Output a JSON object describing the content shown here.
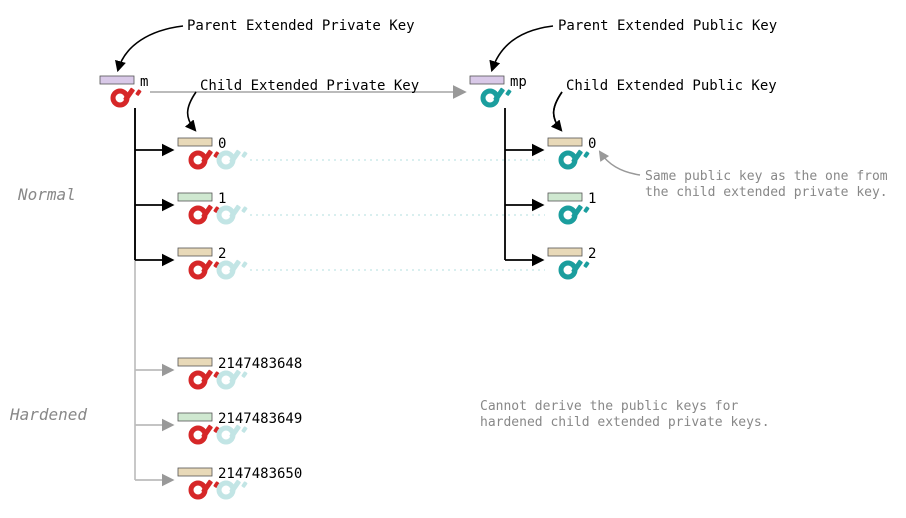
{
  "title": {
    "parent_priv": "Parent Extended Private Key",
    "parent_pub": "Parent Extended Public Key",
    "child_priv": "Child Extended Private Key",
    "child_pub": "Child Extended Public Key"
  },
  "sections": {
    "normal": "Normal",
    "hardened": "Hardened"
  },
  "master": {
    "priv_label": "m",
    "pub_label": "mp"
  },
  "normal_children": {
    "idx": [
      "0",
      "1",
      "2"
    ]
  },
  "hardened_children": {
    "idx": [
      "2147483648",
      "2147483649",
      "2147483650"
    ]
  },
  "notes": {
    "same_pub_l1": "Same public key as the one from",
    "same_pub_l2": "the child extended private key.",
    "no_derive_l1": "Cannot derive the public keys for",
    "no_derive_l2": "hardened child extended private keys."
  },
  "colors": {
    "red": "#d62728",
    "teal": "#1b9e9e",
    "teal_faded": "#c2e5e5",
    "grey": "#999999",
    "black": "#000000",
    "bar_lilac": "#d9c9e8",
    "bar_tan": "#e8d9b8",
    "bar_mint": "#cfe8d0"
  }
}
